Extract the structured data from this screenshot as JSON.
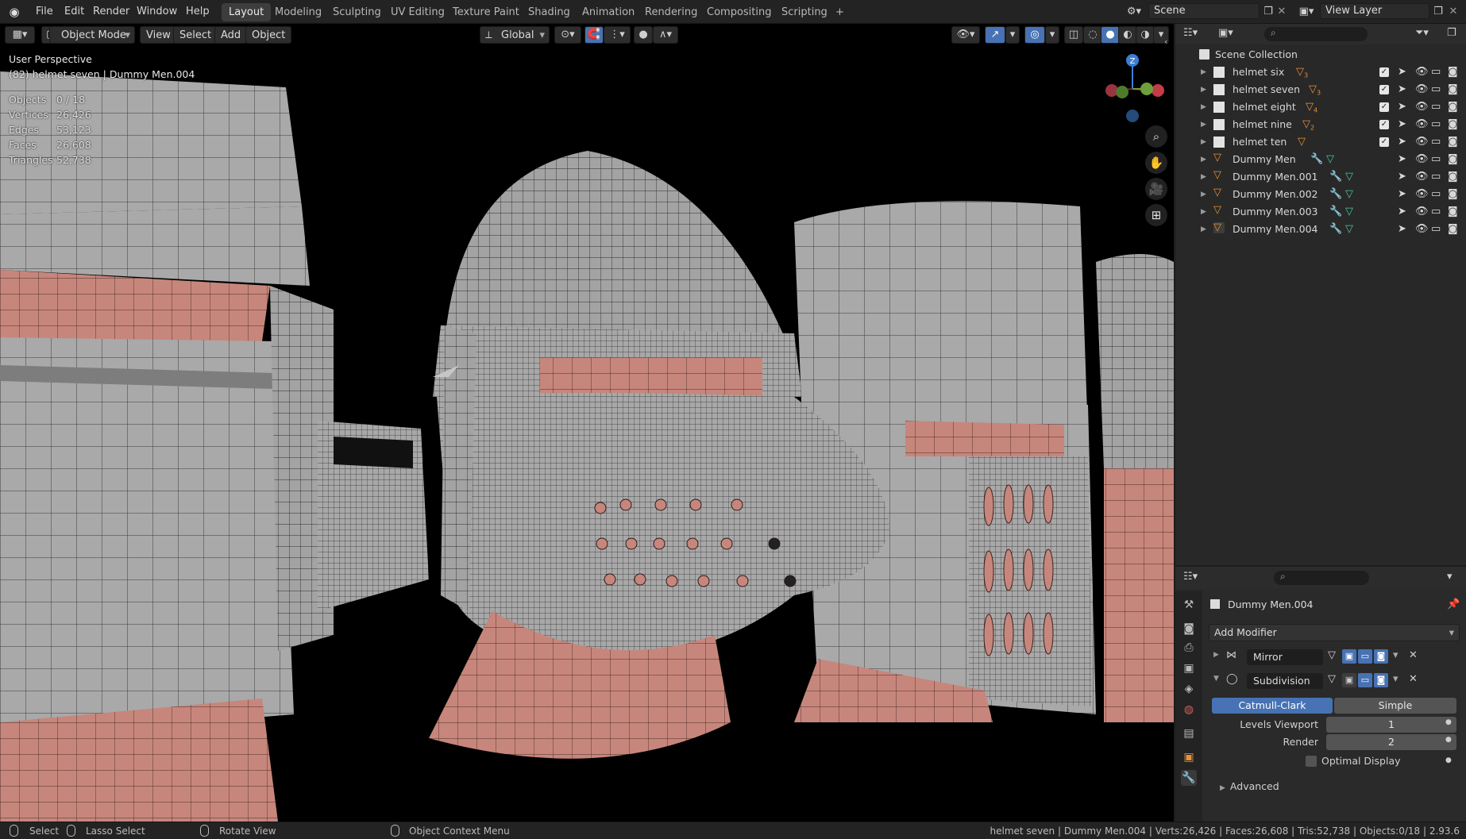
{
  "topbar": {
    "menus": [
      "File",
      "Edit",
      "Render",
      "Window",
      "Help"
    ],
    "workspaces": [
      "Layout",
      "Modeling",
      "Sculpting",
      "UV Editing",
      "Texture Paint",
      "Shading",
      "Animation",
      "Rendering",
      "Compositing",
      "Scripting"
    ],
    "active_workspace": "Layout",
    "add_tab": "+",
    "scene": "Scene",
    "view_layer": "View Layer"
  },
  "viewport_header": {
    "mode": "Object Mode",
    "menus": [
      "View",
      "Select",
      "Add",
      "Object"
    ],
    "orientation": "Global"
  },
  "viewport_overlay": {
    "perspective": "User Perspective",
    "context": "(82) helmet seven | Dummy Men.004",
    "stats": [
      {
        "label": "Objects",
        "value": "0 / 18"
      },
      {
        "label": "Vertices",
        "value": "26,426"
      },
      {
        "label": "Edges",
        "value": "53,123"
      },
      {
        "label": "Faces",
        "value": "26,608"
      },
      {
        "label": "Triangles",
        "value": "52,738"
      }
    ],
    "gizmo": {
      "z": "Z"
    }
  },
  "outliner": {
    "root": "Scene Collection",
    "items": [
      {
        "name": "helmet six",
        "type": "collection",
        "badge": "3"
      },
      {
        "name": "helmet seven",
        "type": "collection",
        "badge": "3"
      },
      {
        "name": "helmet eight",
        "type": "collection",
        "badge": "4"
      },
      {
        "name": "helmet nine",
        "type": "collection",
        "badge": "2"
      },
      {
        "name": "helmet ten",
        "type": "collection",
        "badge": ""
      },
      {
        "name": "Dummy Men",
        "type": "object"
      },
      {
        "name": "Dummy Men.001",
        "type": "object"
      },
      {
        "name": "Dummy Men.002",
        "type": "object"
      },
      {
        "name": "Dummy Men.003",
        "type": "object"
      },
      {
        "name": "Dummy Men.004",
        "type": "object"
      }
    ]
  },
  "properties": {
    "object_name": "Dummy Men.004",
    "add_modifier": "Add Modifier",
    "modifiers": [
      {
        "name": "Mirror",
        "expanded": false
      },
      {
        "name": "Subdivision",
        "expanded": true
      }
    ],
    "subdivision": {
      "type_options": [
        "Catmull-Clark",
        "Simple"
      ],
      "selected_type": "Catmull-Clark",
      "levels_viewport_label": "Levels Viewport",
      "levels_viewport": "1",
      "render_label": "Render",
      "render": "2",
      "optimal_display_label": "Optimal Display",
      "optimal_display": false,
      "advanced_label": "Advanced"
    }
  },
  "statusbar": {
    "select": "Select",
    "lasso": "Lasso Select",
    "rotate": "Rotate View",
    "context_menu": "Object Context Menu",
    "info": "helmet seven | Dummy Men.004 | Verts:26,426 | Faces:26,608 | Tris:52,738 | Objects:0/18 | 2.93.6"
  },
  "colors": {
    "accent": "#4772b3",
    "mesh": "#a8a8a8",
    "skin": "#c98a80",
    "object_orange": "#e8913a",
    "modifier_blue": "#6aa9e8",
    "mesh_green": "#4fc3a0"
  }
}
